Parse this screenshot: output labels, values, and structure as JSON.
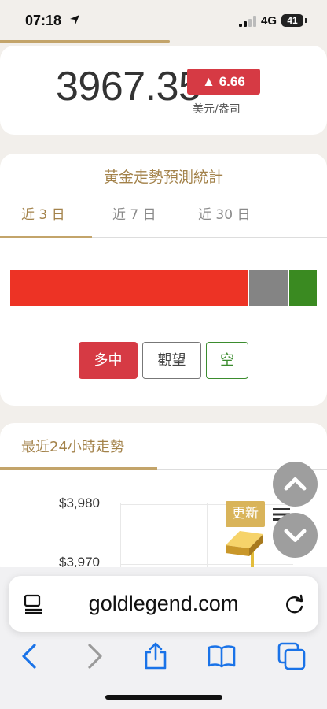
{
  "status_bar": {
    "time": "07:18",
    "network": "4G",
    "battery": "41"
  },
  "page_load_progress": 0.52,
  "price": {
    "value": "3967.35",
    "change": "▲ 6.66",
    "unit": "美元/盎司"
  },
  "forecast": {
    "title": "黃金走勢預測統計",
    "tabs": [
      {
        "label": "近 3 日",
        "active": true
      },
      {
        "label": "近 7 日",
        "active": false
      },
      {
        "label": "近 30 日",
        "active": false
      }
    ],
    "distribution": [
      {
        "key": "long",
        "fraction": 0.78,
        "color": "#ed3325"
      },
      {
        "key": "wait",
        "fraction": 0.13,
        "color": "#848484"
      },
      {
        "key": "short",
        "fraction": 0.09,
        "color": "#3a8a21"
      }
    ],
    "buttons": {
      "long": "多中",
      "wait": "觀望",
      "short": "空"
    }
  },
  "trend": {
    "title": "最近24小時走勢",
    "y_ticks": [
      "$3,980",
      "$3,970"
    ]
  },
  "update_badge": "更新",
  "browser": {
    "url": "goldlegend.com"
  },
  "colors": {
    "accent_gold": "#a3824a",
    "up_red": "#d63a44",
    "down_green": "#3b8c2e"
  }
}
